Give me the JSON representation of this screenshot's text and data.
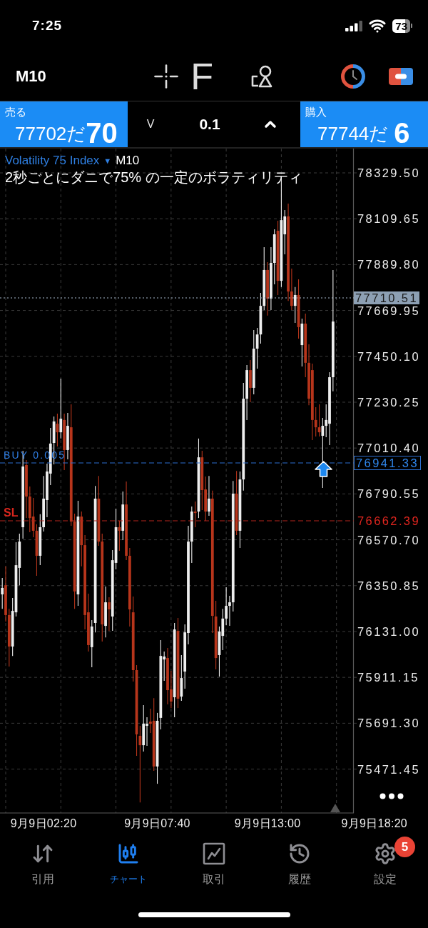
{
  "status_bar": {
    "time": "7:25",
    "battery": "73"
  },
  "toolbar": {
    "timeframe": "M10",
    "indicator_button": "F"
  },
  "trade_panel": {
    "sell": {
      "label": "売る",
      "price_main": "77702だ",
      "price_big": "70"
    },
    "volume": {
      "decrease": "V",
      "value": "0.1"
    },
    "buy": {
      "label": "購入",
      "price_main": "77744だ",
      "price_big": "6"
    }
  },
  "chart": {
    "symbol": "Volatility 75 Index",
    "symbol_caret": "▼",
    "timeframe": "M10",
    "description": "2秒ごとにダニで75% の一定のボラティリティ",
    "chart_data": {
      "type": "candlestick",
      "categories": [
        null,
        null,
        null,
        null,
        null,
        null,
        null,
        null,
        null,
        null,
        null,
        null,
        "9月9日02:20",
        null,
        null,
        null,
        null,
        null,
        null,
        null,
        null,
        null,
        null,
        null,
        null,
        null,
        null,
        null,
        null,
        null,
        null,
        null,
        null,
        null,
        null,
        null,
        null,
        null,
        null,
        null,
        null,
        null,
        null,
        null,
        null,
        "9月9日07:40",
        null,
        null,
        null,
        null,
        null,
        null,
        null,
        null,
        null,
        null,
        null,
        null,
        null,
        null,
        null,
        null,
        null,
        null,
        null,
        null,
        null,
        null,
        null,
        null,
        null,
        null,
        null,
        null,
        null,
        null,
        null,
        "9月9日13:00",
        null,
        null,
        null,
        null,
        null,
        null,
        null,
        null,
        null,
        null,
        null,
        null,
        null,
        null,
        null,
        null,
        null,
        null,
        null,
        null,
        null,
        null,
        null,
        null,
        null,
        null,
        null,
        null,
        null,
        null,
        "9月9日18:20"
      ],
      "ohlc": [
        [
          76309,
          76388,
          76240,
          76340
        ],
        [
          76353,
          76443,
          76179,
          76210
        ],
        [
          76210,
          76240,
          75963,
          76059
        ],
        [
          76059,
          76292,
          76014,
          76230
        ],
        [
          76223,
          76559,
          76203,
          76449
        ],
        [
          76436,
          76600,
          76353,
          76562
        ],
        [
          76631,
          76997,
          76576,
          76922
        ],
        [
          76929,
          76953,
          76675,
          76778
        ],
        [
          76778,
          76826,
          76607,
          76675
        ],
        [
          76682,
          76771,
          76583,
          76614
        ],
        [
          76614,
          76645,
          76398,
          76494
        ],
        [
          76494,
          76693,
          76449,
          76631
        ],
        [
          76631,
          76877,
          76610,
          76768
        ],
        [
          76761,
          76936,
          76679,
          76898
        ],
        [
          76888,
          77107,
          76833,
          77032
        ],
        [
          77035,
          77162,
          76932,
          77138
        ],
        [
          77127,
          77175,
          77018,
          77086
        ],
        [
          77086,
          77343,
          77056,
          77151
        ],
        [
          77145,
          77175,
          76905,
          77001
        ],
        [
          77001,
          77179,
          76956,
          77117
        ],
        [
          77110,
          77220,
          76638,
          76658
        ],
        [
          76658,
          76696,
          76240,
          76323
        ],
        [
          76309,
          76758,
          76254,
          76682
        ],
        [
          76682,
          76706,
          76443,
          76545
        ],
        [
          76545,
          76593,
          76141,
          76210
        ],
        [
          76223,
          76312,
          76035,
          76066
        ],
        [
          76056,
          76186,
          75960,
          76155
        ],
        [
          76172,
          76829,
          76127,
          76768
        ],
        [
          76768,
          76877,
          76542,
          76562
        ],
        [
          76562,
          76600,
          76083,
          76165
        ],
        [
          76158,
          76347,
          76103,
          76271
        ],
        [
          76271,
          76295,
          76134,
          76237
        ],
        [
          76203,
          76521,
          76134,
          76473
        ],
        [
          76460,
          76720,
          76429,
          76631
        ],
        [
          76631,
          76662,
          76518,
          76614
        ],
        [
          76614,
          76802,
          76569,
          76740
        ],
        [
          76740,
          76850,
          76473,
          76494
        ],
        [
          76494,
          76532,
          76155,
          76237
        ],
        [
          76223,
          76299,
          75891,
          75946
        ],
        [
          75946,
          75970,
          75535,
          75638
        ],
        [
          75631,
          75679,
          75312,
          75586
        ],
        [
          75586,
          75778,
          75556,
          75689
        ],
        [
          75679,
          75720,
          75583,
          75689
        ],
        [
          75699,
          75761,
          75645,
          75689
        ],
        [
          75703,
          75812,
          75463,
          75484
        ],
        [
          75484,
          75741,
          75401,
          75703
        ],
        [
          75717,
          76090,
          75662,
          76014
        ],
        [
          75997,
          76035,
          75895,
          76011
        ],
        [
          76004,
          76052,
          75782,
          75850
        ],
        [
          75854,
          75943,
          75764,
          75795
        ],
        [
          75816,
          76172,
          75720,
          76141
        ],
        [
          76134,
          76196,
          75764,
          75809
        ],
        [
          75819,
          76018,
          75799,
          75908
        ],
        [
          75939,
          76165,
          75857,
          76127
        ],
        [
          76124,
          76638,
          76069,
          76562
        ],
        [
          76562,
          76730,
          76460,
          76706
        ],
        [
          76706,
          76754,
          76631,
          76699
        ],
        [
          76706,
          77056,
          76675,
          76966
        ],
        [
          76966,
          76997,
          76713,
          76809
        ],
        [
          76812,
          76874,
          76662,
          76706
        ],
        [
          76706,
          76877,
          76686,
          76768
        ],
        [
          76768,
          76806,
          76124,
          76206
        ],
        [
          76203,
          76278,
          75949,
          76004
        ],
        [
          76018,
          76155,
          75915,
          76131
        ],
        [
          76110,
          76240,
          76042,
          76193
        ],
        [
          76193,
          76343,
          76162,
          76254
        ],
        [
          76254,
          76302,
          76158,
          76271
        ],
        [
          76271,
          76853,
          76227,
          76792
        ],
        [
          76792,
          76901,
          76593,
          76614
        ],
        [
          76614,
          76898,
          76532,
          76860
        ],
        [
          76860,
          77323,
          76806,
          77247
        ],
        [
          77247,
          77408,
          77145,
          77384
        ],
        [
          77384,
          77432,
          77230,
          77299
        ],
        [
          77299,
          77576,
          77268,
          77487
        ],
        [
          77487,
          77586,
          77391,
          77555
        ],
        [
          77555,
          77754,
          77511,
          77692
        ],
        [
          77692,
          77973,
          77672,
          77864
        ],
        [
          77864,
          77901,
          77645,
          77727
        ],
        [
          77727,
          77973,
          77672,
          77898
        ],
        [
          77898,
          78059,
          77795,
          78035
        ],
        [
          78052,
          78100,
          77744,
          77812
        ],
        [
          77812,
          78309,
          77782,
          78103
        ],
        [
          78035,
          78151,
          77939,
          78121
        ],
        [
          78121,
          78182,
          77716,
          77761
        ],
        [
          77761,
          77871,
          77672,
          77692
        ],
        [
          77692,
          77782,
          77610,
          77744
        ],
        [
          77744,
          77819,
          77535,
          77590
        ],
        [
          77504,
          77631,
          77401,
          77607
        ],
        [
          77607,
          77655,
          77350,
          77419
        ],
        [
          77419,
          77508,
          77216,
          77247
        ],
        [
          77384,
          77415,
          77049,
          77145
        ],
        [
          77145,
          77206,
          77066,
          77110
        ],
        [
          77110,
          77220,
          77066,
          77086
        ],
        [
          77069,
          77155,
          76819,
          77117
        ],
        [
          77117,
          77220,
          77062,
          77145
        ],
        [
          77127,
          77374,
          77025,
          77350
        ],
        [
          77350,
          77864,
          77282,
          77617
        ],
        null,
        null,
        null,
        null,
        null,
        null,
        null,
        null,
        null,
        null,
        null,
        null
      ],
      "ylim": [
        75261.1,
        78445.9
      ],
      "yticks": [
        {
          "value": 78329.5,
          "label": "78329.50"
        },
        {
          "value": 78109.65,
          "label": "78109.65"
        },
        {
          "value": 77889.8,
          "label": "77889.80"
        },
        {
          "value": 77669.95,
          "label": "77669.95"
        },
        {
          "value": 77450.1,
          "label": "77450.10"
        },
        {
          "value": 77230.25,
          "label": "77230.25"
        },
        {
          "value": 77010.4,
          "label": "77010.40"
        },
        {
          "value": 76790.55,
          "label": "76790.55"
        },
        {
          "value": 76570.7,
          "label": "76570.70"
        },
        {
          "value": 76350.85,
          "label": "76350.85"
        },
        {
          "value": 76131,
          "label": "76131.00"
        },
        {
          "value": 75911.15,
          "label": "75911.15"
        },
        {
          "value": 75691.3,
          "label": "75691.30"
        },
        {
          "value": 75471.45,
          "label": "75471.45"
        }
      ]
    },
    "current_price": "77710.51",
    "order_line": {
      "label": "BUY 0.005",
      "price": "76941.33"
    },
    "stop_loss_line": {
      "label": "SL",
      "price": "76662.39"
    }
  },
  "tab_bar": [
    {
      "label": "引用",
      "selected": false
    },
    {
      "label": "チャート",
      "selected": true
    },
    {
      "label": "取引",
      "selected": false
    },
    {
      "label": "履歴",
      "selected": false
    },
    {
      "label": "設定",
      "selected": false,
      "badge": "5"
    }
  ]
}
